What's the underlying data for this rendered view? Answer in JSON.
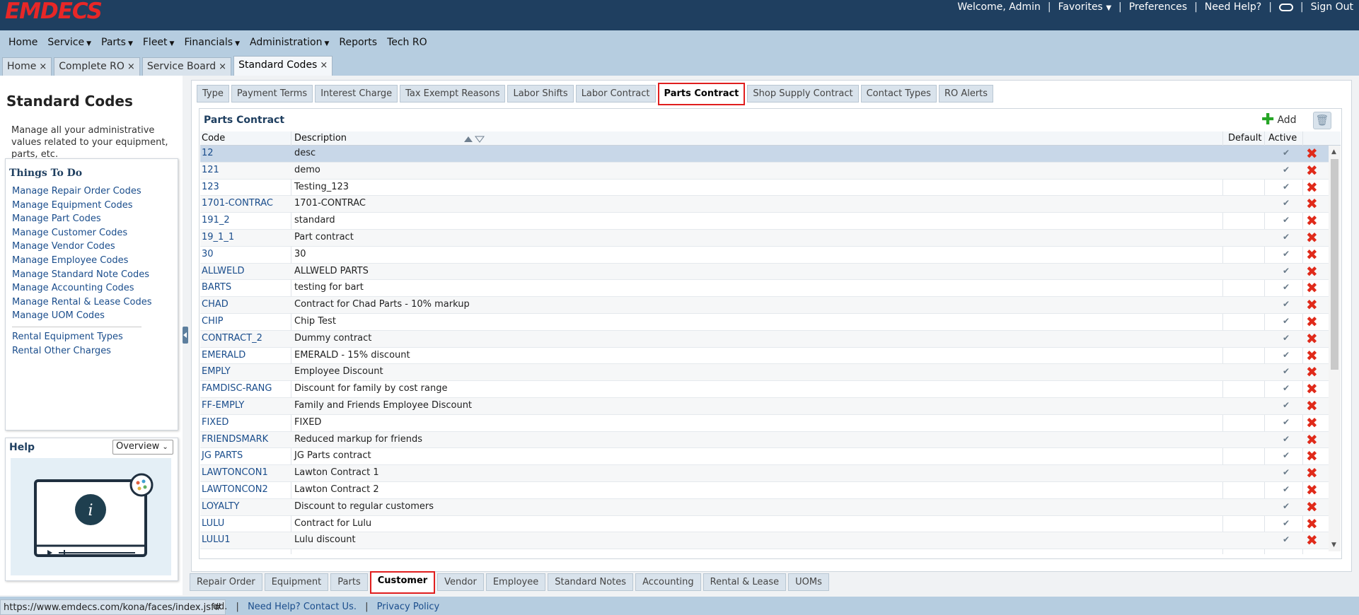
{
  "brand": {
    "logo_text": "EMDECS",
    "logo_color": "#e82727"
  },
  "topbar": {
    "welcome": "Welcome, Admin",
    "favorites": "Favorites",
    "preferences": "Preferences",
    "need_help": "Need Help?",
    "sign_out": "Sign Out"
  },
  "nav": [
    {
      "label": "Home",
      "dropdown": false
    },
    {
      "label": "Service",
      "dropdown": true
    },
    {
      "label": "Parts",
      "dropdown": true
    },
    {
      "label": "Fleet",
      "dropdown": true
    },
    {
      "label": "Financials",
      "dropdown": true
    },
    {
      "label": "Administration",
      "dropdown": true
    },
    {
      "label": "Reports",
      "dropdown": false
    },
    {
      "label": "Tech RO",
      "dropdown": false
    }
  ],
  "workspace_tabs": [
    {
      "label": "Home",
      "active": false
    },
    {
      "label": "Complete RO",
      "active": false
    },
    {
      "label": "Service Board",
      "active": false
    },
    {
      "label": "Standard Codes",
      "active": true
    }
  ],
  "left_panel": {
    "title": "Standard Codes",
    "description": "Manage all your administrative values related to your equipment, parts, etc.",
    "things_to_do_title": "Things To Do",
    "links": [
      "Manage Repair Order Codes",
      "Manage Equipment Codes",
      "Manage Part Codes",
      "Manage Customer Codes",
      "Manage Vendor Codes",
      "Manage Employee Codes",
      "Manage Standard Note Codes",
      "Manage Accounting Codes",
      "Manage Rental & Lease Codes",
      "Manage UOM Codes"
    ],
    "links2": [
      "Rental Equipment Types",
      "Rental Other Charges"
    ],
    "help_title": "Help",
    "help_select": "Overview"
  },
  "sub_tabs": [
    {
      "label": "Type",
      "active": false
    },
    {
      "label": "Payment Terms",
      "active": false
    },
    {
      "label": "Interest Charge",
      "active": false
    },
    {
      "label": "Tax Exempt Reasons",
      "active": false
    },
    {
      "label": "Labor Shifts",
      "active": false
    },
    {
      "label": "Labor Contract",
      "active": false
    },
    {
      "label": "Parts Contract",
      "active": true
    },
    {
      "label": "Shop Supply Contract",
      "active": false
    },
    {
      "label": "Contact Types",
      "active": false
    },
    {
      "label": "RO Alerts",
      "active": false
    }
  ],
  "grid": {
    "title": "Parts Contract",
    "add_label": "Add",
    "columns": {
      "code": "Code",
      "description": "Description",
      "default": "Default",
      "active": "Active"
    },
    "rows": [
      {
        "code": "12",
        "description": "desc",
        "active": "✔",
        "selected": true
      },
      {
        "code": "121",
        "description": "demo",
        "active": "✔"
      },
      {
        "code": "123",
        "description": "Testing_123",
        "active": "✔"
      },
      {
        "code": "1701-CONTRAC",
        "description": "1701-CONTRAC",
        "active": "✔"
      },
      {
        "code": "191_2",
        "description": "standard",
        "active": "✔"
      },
      {
        "code": "19_1_1",
        "description": "Part contract",
        "active": "✔"
      },
      {
        "code": "30",
        "description": "30",
        "active": "✔"
      },
      {
        "code": "ALLWELD",
        "description": "ALLWELD PARTS",
        "active": "✔"
      },
      {
        "code": "BARTS",
        "description": "testing for bart",
        "active": "✔"
      },
      {
        "code": "CHAD",
        "description": "Contract for Chad Parts - 10% markup",
        "active": "✔"
      },
      {
        "code": "CHIP",
        "description": "Chip Test",
        "active": "✔"
      },
      {
        "code": "CONTRACT_2",
        "description": "Dummy contract",
        "active": "✔"
      },
      {
        "code": "EMERALD",
        "description": "EMERALD - 15% discount",
        "active": "✔"
      },
      {
        "code": "EMPLY",
        "description": "Employee Discount",
        "active": "✔"
      },
      {
        "code": "FAMDISC-RANG",
        "description": "Discount for family by cost range",
        "active": "✔"
      },
      {
        "code": "FF-EMPLY",
        "description": "Family and Friends Employee Discount",
        "active": "✔"
      },
      {
        "code": "FIXED",
        "description": "FIXED",
        "active": "✔"
      },
      {
        "code": "FRIENDSMARK",
        "description": "Reduced markup for friends",
        "active": "✔"
      },
      {
        "code": "JG PARTS",
        "description": "JG Parts contract",
        "active": "✔"
      },
      {
        "code": "LAWTONCON1",
        "description": "Lawton Contract 1",
        "active": "✔"
      },
      {
        "code": "LAWTONCON2",
        "description": "Lawton Contract 2",
        "active": "✔"
      },
      {
        "code": "LOYALTY",
        "description": "Discount to regular customers",
        "active": "✔"
      },
      {
        "code": "LULU",
        "description": "Contract for Lulu",
        "active": "✔"
      },
      {
        "code": "LULU1",
        "description": "Lulu discount",
        "active": "✔"
      }
    ]
  },
  "bottom_tabs": [
    {
      "label": "Repair Order",
      "active": false
    },
    {
      "label": "Equipment",
      "active": false
    },
    {
      "label": "Parts",
      "active": false
    },
    {
      "label": "Customer",
      "active": true
    },
    {
      "label": "Vendor",
      "active": false
    },
    {
      "label": "Employee",
      "active": false
    },
    {
      "label": "Standard Notes",
      "active": false
    },
    {
      "label": "Accounting",
      "active": false
    },
    {
      "label": "Rental & Lease",
      "active": false
    },
    {
      "label": "UOMs",
      "active": false
    }
  ],
  "footer": {
    "status_url": "https://www.emdecs.com/kona/faces/index.jsf#",
    "partial_text": "ed.",
    "help_link": "Need Help? Contact Us.",
    "privacy_link": "Privacy Policy"
  },
  "colors": {
    "header_bg": "#1f3f60",
    "nav_bg": "#b6cde0",
    "highlight_border": "#e01e1e",
    "link": "#1a4d8c"
  }
}
